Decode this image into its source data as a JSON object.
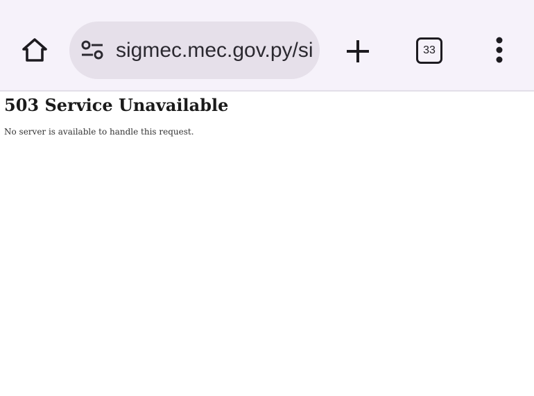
{
  "browser": {
    "url": "sigmec.mec.gov.py/sigmec",
    "tab_count": "33",
    "icons": {
      "home": "home-icon",
      "site_settings": "tune-icon",
      "new_tab": "plus-icon",
      "tab_switcher": "tab-count-icon",
      "menu": "more-vert-icon"
    },
    "colors": {
      "toolbar_bg": "#f6f2fa",
      "url_pill_bg": "#e6e0ea"
    }
  },
  "page": {
    "title": "503 Service Unavailable",
    "message": "No server is available to handle this request."
  }
}
